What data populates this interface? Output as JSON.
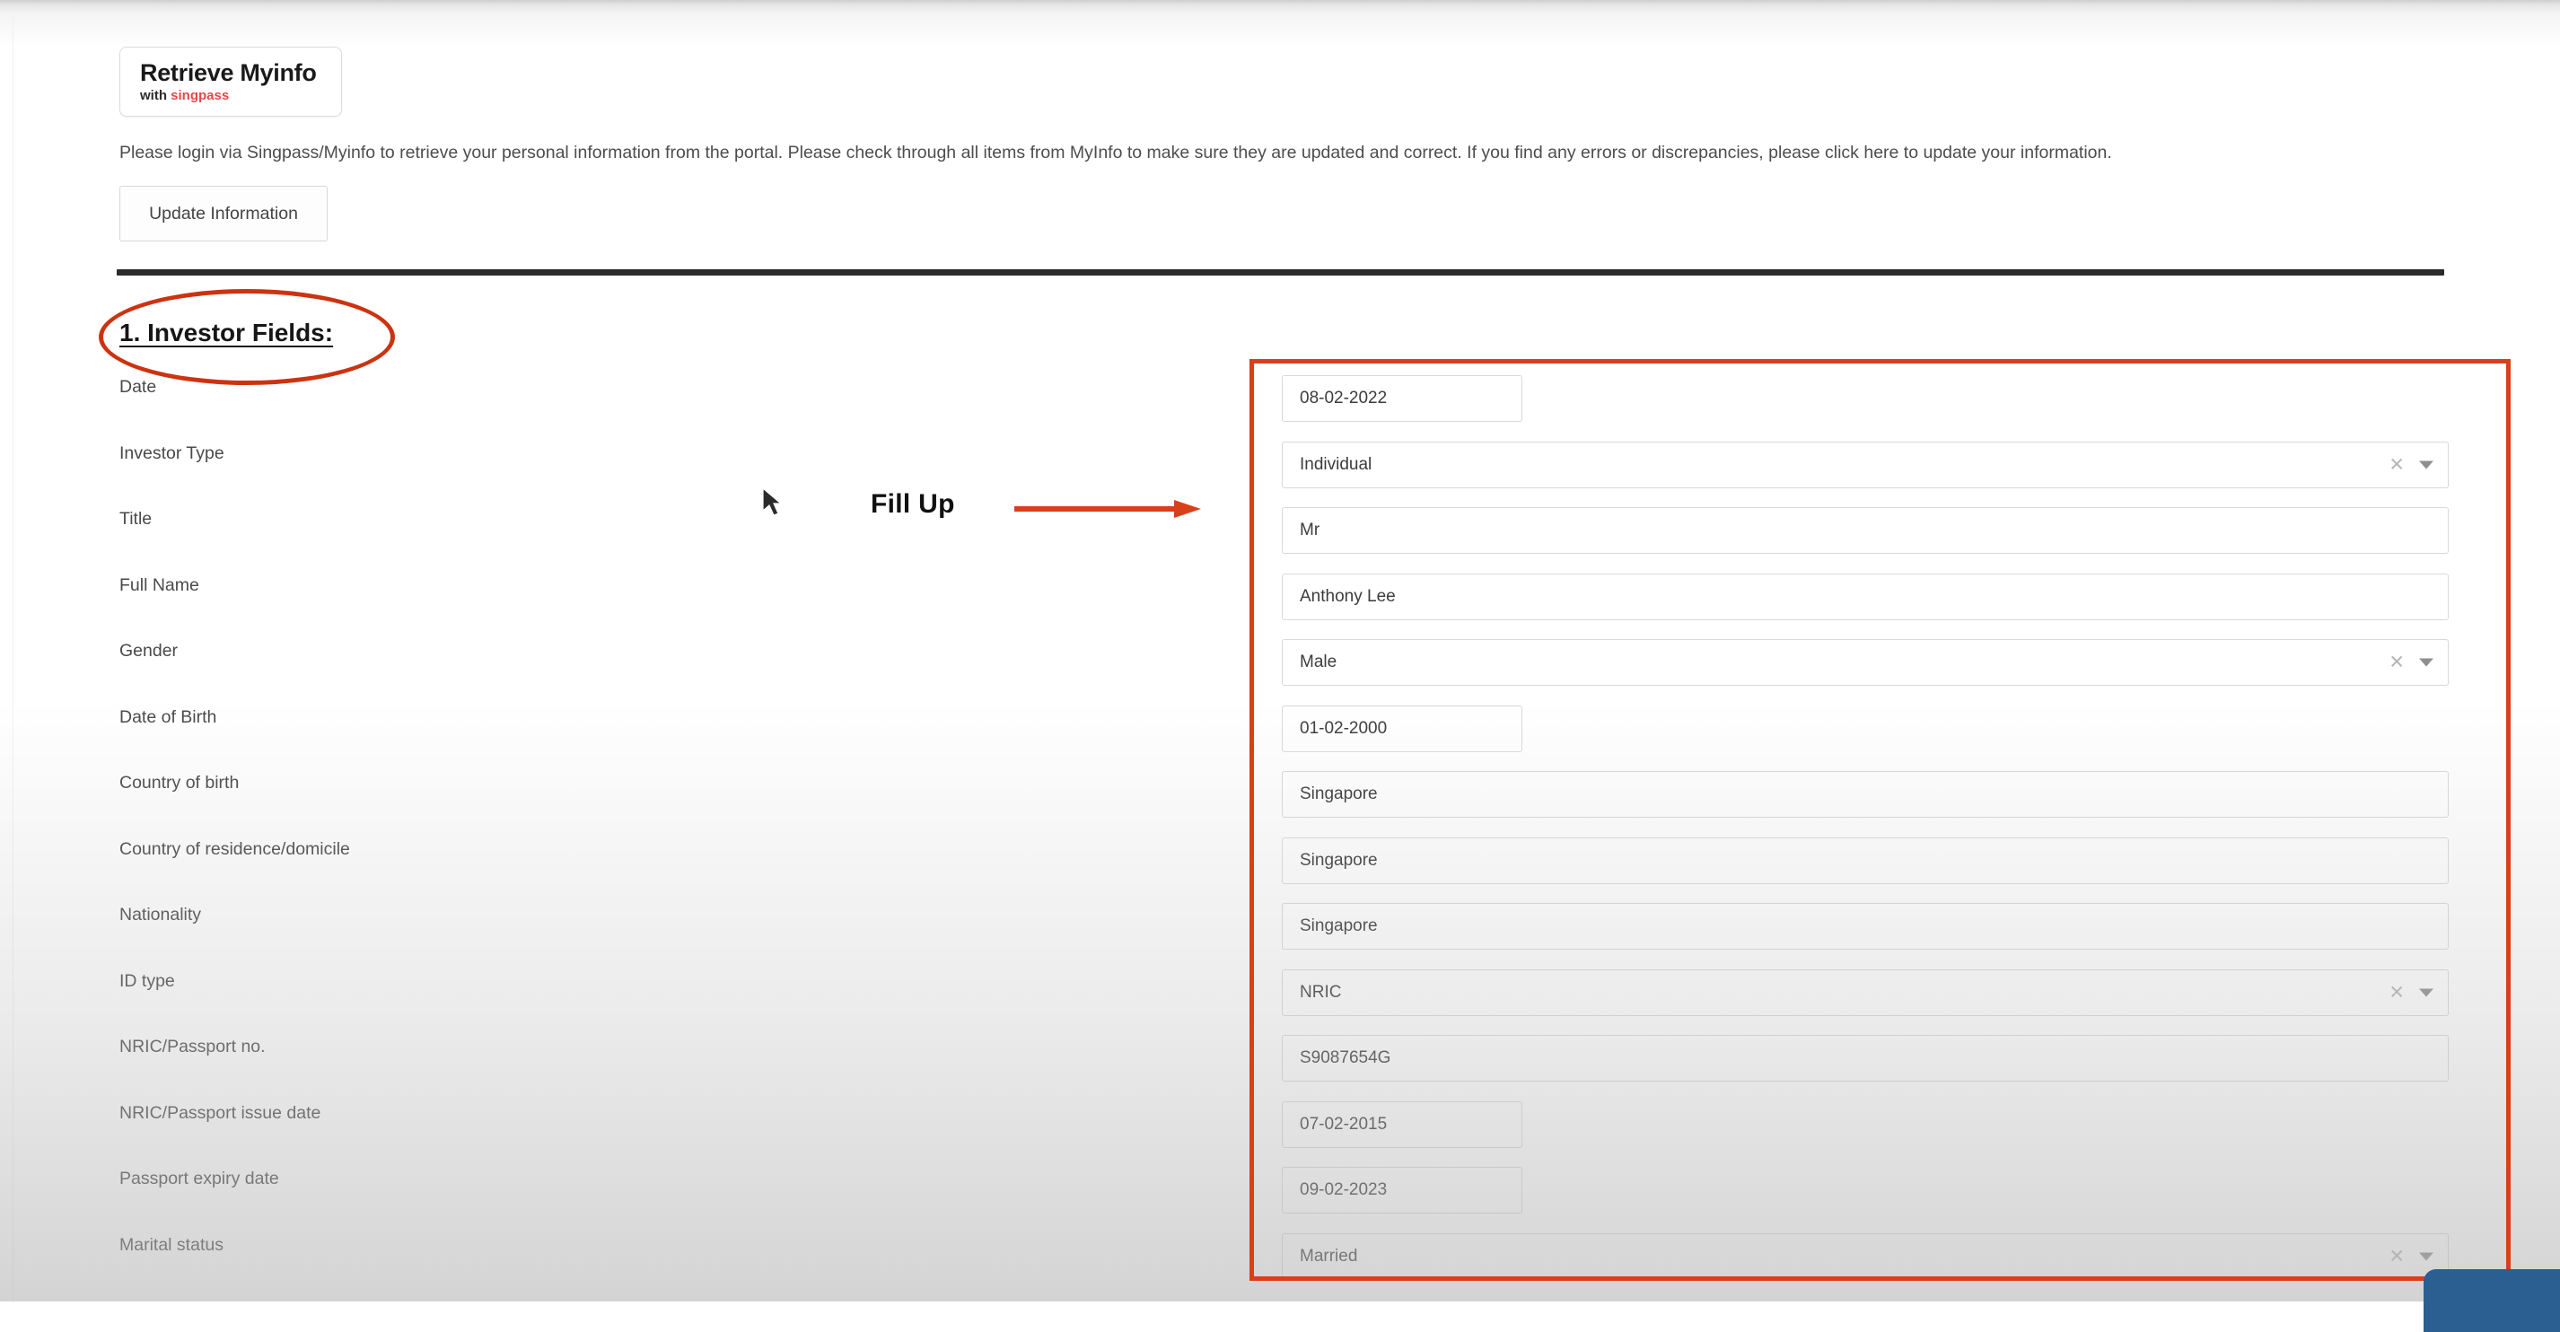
{
  "header": {
    "myinfo_button": {
      "title": "Retrieve Myinfo",
      "with_label": "with",
      "brand": "singpass"
    },
    "intro_paragraph": "Please login via Singpass/Myinfo to retrieve your personal information from the portal. Please check through all items from MyInfo to make sure they are updated and correct. If you find any errors or discrepancies, please click here to update your information.",
    "update_button": "Update Information"
  },
  "section": {
    "title": "1. Investor Fields:"
  },
  "annotations": {
    "fill_up": "Fill Up",
    "accent_red": "#d8401a",
    "ellipse_red": "#cc3311"
  },
  "form": {
    "fields": [
      {
        "label": "Date",
        "value": "08-02-2022",
        "type": "date"
      },
      {
        "label": "Investor Type",
        "value": "Individual",
        "type": "select"
      },
      {
        "label": "Title",
        "value": "Mr",
        "type": "text"
      },
      {
        "label": "Full Name",
        "value": "Anthony Lee",
        "type": "text"
      },
      {
        "label": "Gender",
        "value": "Male",
        "type": "select"
      },
      {
        "label": "Date of Birth",
        "value": "01-02-2000",
        "type": "date"
      },
      {
        "label": "Country of birth",
        "value": "Singapore",
        "type": "text"
      },
      {
        "label": "Country of residence/domicile",
        "value": "Singapore",
        "type": "text"
      },
      {
        "label": "Nationality",
        "value": "Singapore",
        "type": "text"
      },
      {
        "label": "ID type",
        "value": "NRIC",
        "type": "select"
      },
      {
        "label": "NRIC/Passport no.",
        "value": "S9087654G",
        "type": "text"
      },
      {
        "label": "NRIC/Passport issue date",
        "value": "07-02-2015",
        "type": "date"
      },
      {
        "label": "Passport expiry date",
        "value": "09-02-2023",
        "type": "date"
      },
      {
        "label": "Marital status",
        "value": "Married",
        "type": "select"
      }
    ]
  }
}
